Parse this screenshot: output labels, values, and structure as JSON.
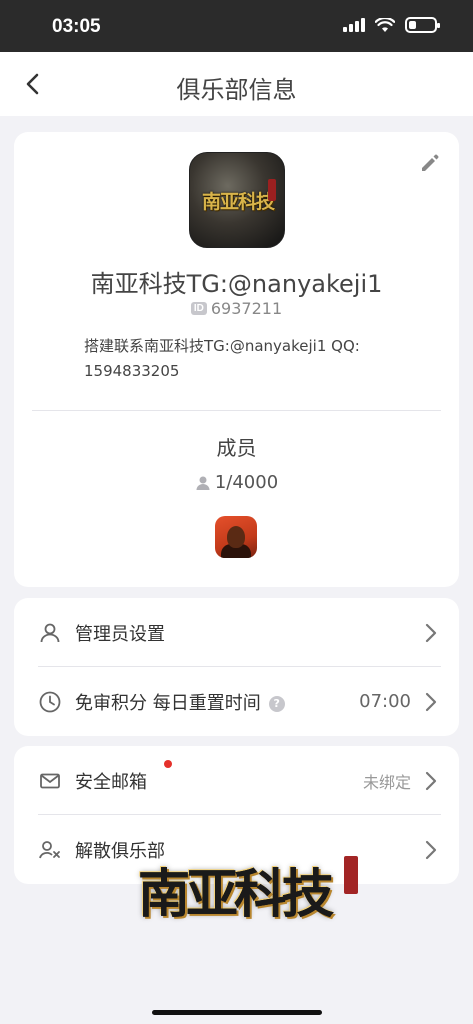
{
  "status_bar": {
    "time": "03:05",
    "battery_fraction": 0.25
  },
  "nav": {
    "title": "俱乐部信息"
  },
  "club": {
    "logo_text": "南亚科技",
    "name": "南亚科技TG:@nanyakeji1",
    "id_badge": "ID",
    "id": "6937211",
    "description": "搭建联系南亚科技TG:@nanyakeji1 QQ: 1594833205",
    "members_title": "成员",
    "members_count": "1/4000"
  },
  "menu1": {
    "admin_settings": "管理员设置",
    "free_review_label": "免审积分 每日重置时间",
    "free_review_time": "07:00"
  },
  "menu2": {
    "secure_email": "安全邮箱",
    "secure_email_status": "未绑定",
    "dissolve_club": "解散俱乐部"
  },
  "watermark": {
    "text": "南亚科技"
  },
  "colors": {
    "accent_red": "#e5312b",
    "background": "#f2f2f6"
  }
}
